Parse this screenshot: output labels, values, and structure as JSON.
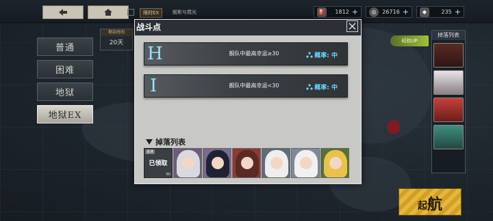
{
  "topbar": {
    "back_icon": "back-arrow-icon",
    "home_icon": "home-icon",
    "event_tag": "限时EX",
    "event_text": "舰影与霓光",
    "resources": [
      {
        "icon": "oil-icon",
        "value": "1812"
      },
      {
        "icon": "coin-icon",
        "value": "26716"
      },
      {
        "icon": "gem-icon",
        "value": "235"
      }
    ]
  },
  "difficulty": {
    "tabs": [
      "普通",
      "困难",
      "地狱",
      "地狱EX"
    ],
    "active": 3
  },
  "left_info": {
    "label": "剩余时间",
    "value": "20天"
  },
  "drop_column_title": "掉落列表",
  "rate_up_label": "经验UP",
  "sortie": {
    "small": "起",
    "big": "航"
  },
  "modal": {
    "title": "战斗点",
    "nodes": [
      {
        "letter": "H",
        "condition": "舰队中最高幸运≥30",
        "probability": "概率: 中"
      },
      {
        "letter": "I",
        "condition": "舰队中最高幸运<30",
        "probability": "概率: 中"
      }
    ],
    "drops_title": "掉落列表",
    "drops": [
      {
        "type": "claimed",
        "tag": "首通",
        "label": "已领取",
        "count": "80"
      },
      {
        "type": "character",
        "hair": "#d9d9df",
        "bg": "#6a5d7d"
      },
      {
        "type": "character",
        "hair": "#1f2234",
        "bg": "#7b6a8c"
      },
      {
        "type": "character",
        "hair": "#5a2b25",
        "bg": "#8c3a33"
      },
      {
        "type": "character",
        "hair": "#eeeeee",
        "bg": "#5f6c7a"
      },
      {
        "type": "character",
        "hair": "#f0f0f2",
        "bg": "#7f8a99"
      },
      {
        "type": "character",
        "hair": "#e8c24a",
        "bg": "#586f38"
      }
    ]
  },
  "colors": {
    "accent_cyan": "#6fd7ff",
    "sortie_yellow": "#e6b73a"
  }
}
